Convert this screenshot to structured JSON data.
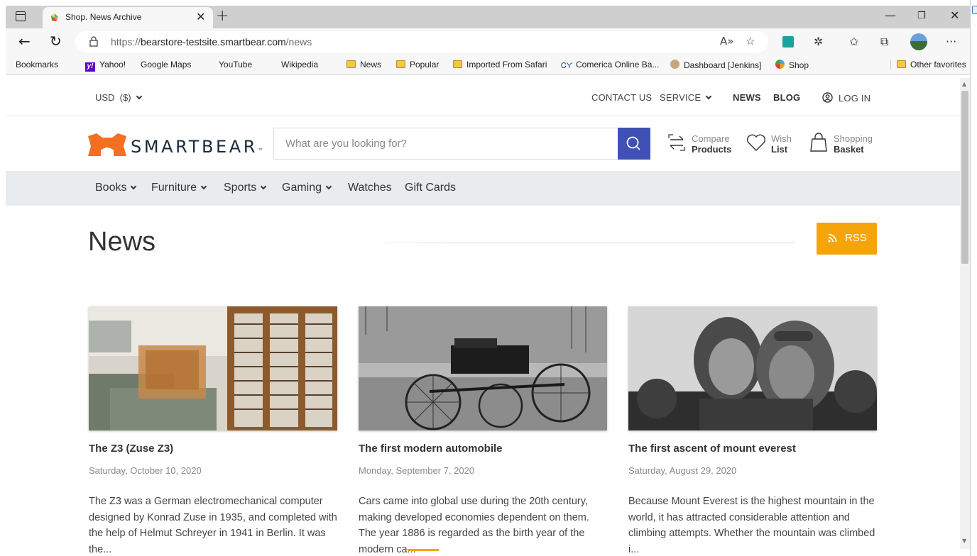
{
  "browser": {
    "tab_title": "Shop. News Archive",
    "url_scheme": "https://",
    "url_host": "bearstore-testsite.smartbear.com",
    "url_path": "/news",
    "bookmarks": [
      {
        "label": "Bookmarks",
        "icon": "page-icon"
      },
      {
        "label": "Yahoo!",
        "icon": "yahoo-icon"
      },
      {
        "label": "Google Maps",
        "icon": "page-icon"
      },
      {
        "label": "YouTube",
        "icon": "page-icon"
      },
      {
        "label": "Wikipedia",
        "icon": "page-icon"
      },
      {
        "label": "News",
        "icon": "folder-icon"
      },
      {
        "label": "Popular",
        "icon": "folder-icon"
      },
      {
        "label": "Imported From Safari",
        "icon": "folder-icon"
      },
      {
        "label": "Comerica Online Ba...",
        "icon": "comerica-icon"
      },
      {
        "label": "Dashboard [Jenkins]",
        "icon": "jenkins-icon"
      },
      {
        "label": "Shop",
        "icon": "shop-icon"
      }
    ],
    "other_favorites": "Other favorites"
  },
  "topbar": {
    "currency": "USD  ($)",
    "contact": "CONTACT US",
    "service": "SERVICE",
    "news": "NEWS",
    "blog": "BLOG",
    "login": "LOG IN"
  },
  "header": {
    "brand": "SMARTBEAR",
    "brand_tm": "™",
    "search_placeholder": "What are you looking for?",
    "compare_l1": "Compare",
    "compare_l2": "Products",
    "wish_l1": "Wish",
    "wish_l2": "List",
    "basket_l1": "Shopping",
    "basket_l2": "Basket"
  },
  "menu": [
    "Books",
    "Furniture",
    "Sports",
    "Gaming",
    "Watches",
    "Gift Cards"
  ],
  "main": {
    "title": "News",
    "rss_label": "RSS"
  },
  "news": [
    {
      "title": "The Z3 (Zuse Z3)",
      "date": "Saturday, October 10, 2020",
      "body": "The Z3 was a German electromechanical computer designed by Konrad Zuse in 1935, and completed with the help of Helmut Schreyer in 1941 in Berlin. It was the..."
    },
    {
      "title": "The first modern automobile",
      "date": "Monday, September 7, 2020",
      "body": "Cars came into global use during the 20th century, making developed economies dependent on them. The year 1886 is regarded as the birth year of the modern ca..."
    },
    {
      "title": "The first ascent of mount everest",
      "date": "Saturday, August 29, 2020",
      "body": "Because Mount Everest is the highest mountain in the world, it has attracted considerable attention and climbing attempts. Whether the mountain was climbed i..."
    }
  ],
  "colors": {
    "brand_orange": "#f5a409",
    "search_button": "#3f51b5",
    "logo_orange": "#f36f21"
  }
}
